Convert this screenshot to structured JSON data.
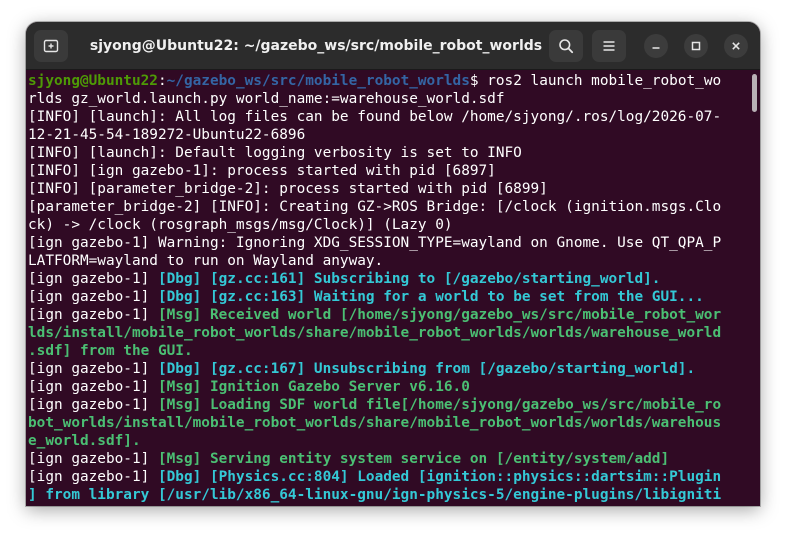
{
  "window": {
    "title": "sjyong@Ubuntu22: ~/gazebo_ws/src/mobile_robot_worlds"
  },
  "titlebar": {
    "new_tab_icon": "new-tab-icon",
    "search_icon": "search-icon",
    "menu_icon": "hamburger-menu-icon",
    "minimize_icon": "minimize-icon",
    "maximize_icon": "maximize-icon",
    "close_icon": "close-icon"
  },
  "colors": {
    "background": "#300a24",
    "titlebar": "#2c2c2c",
    "text": "#ffffff",
    "prompt_user": "#4e9a06",
    "prompt_path": "#3465a4",
    "dbg": "#34c9d6",
    "msg": "#4bbf73"
  },
  "terminal": {
    "lines": [
      [
        {
          "t": "sjyong@Ubuntu22",
          "c": "userhost"
        },
        {
          "t": ":",
          "c": ""
        },
        {
          "t": "~/gazebo_ws/src/mobile_robot_worlds",
          "c": "path"
        },
        {
          "t": "$ ros2 launch mobile_robot_wo",
          "c": ""
        }
      ],
      [
        {
          "t": "rlds gz_world.launch.py world_name:=warehouse_world.sdf",
          "c": ""
        }
      ],
      [
        {
          "t": "[INFO] [launch]: All log files can be found below /home/sjyong/.ros/log/2026-07-",
          "c": ""
        }
      ],
      [
        {
          "t": "12-21-45-54-189272-Ubuntu22-6896",
          "c": ""
        }
      ],
      [
        {
          "t": "[INFO] [launch]: Default logging verbosity is set to INFO",
          "c": ""
        }
      ],
      [
        {
          "t": "[INFO] [ign gazebo-1]: process started with pid [6897]",
          "c": ""
        }
      ],
      [
        {
          "t": "[INFO] [parameter_bridge-2]: process started with pid [6899]",
          "c": ""
        }
      ],
      [
        {
          "t": "[parameter_bridge-2] [INFO]: Creating GZ->ROS Bridge: [/clock (ignition.msgs.Clo",
          "c": ""
        }
      ],
      [
        {
          "t": "ck) -> /clock (rosgraph_msgs/msg/Clock)] (Lazy 0)",
          "c": ""
        }
      ],
      [
        {
          "t": "[ign gazebo-1] Warning: Ignoring XDG_SESSION_TYPE=wayland on Gnome. Use QT_QPA_P",
          "c": ""
        }
      ],
      [
        {
          "t": "LATFORM=wayland to run on Wayland anyway.",
          "c": ""
        }
      ],
      [
        {
          "t": "[ign gazebo-1] ",
          "c": ""
        },
        {
          "t": "[Dbg] [gz.cc:161] Subscribing to [/gazebo/starting_world].",
          "c": "dbg"
        }
      ],
      [
        {
          "t": "[ign gazebo-1] ",
          "c": ""
        },
        {
          "t": "[Dbg] [gz.cc:163] Waiting for a world to be set from the GUI...",
          "c": "dbg"
        }
      ],
      [
        {
          "t": "[ign gazebo-1] ",
          "c": ""
        },
        {
          "t": "[Msg] Received world [/home/sjyong/gazebo_ws/src/mobile_robot_wor",
          "c": "msg"
        }
      ],
      [
        {
          "t": "lds/install/mobile_robot_worlds/share/mobile_robot_worlds/worlds/warehouse_world",
          "c": "msg"
        }
      ],
      [
        {
          "t": ".sdf] from the GUI.",
          "c": "msg"
        }
      ],
      [
        {
          "t": "[ign gazebo-1] ",
          "c": ""
        },
        {
          "t": "[Dbg] [gz.cc:167] Unsubscribing from [/gazebo/starting_world].",
          "c": "dbg"
        }
      ],
      [
        {
          "t": "[ign gazebo-1] ",
          "c": ""
        },
        {
          "t": "[Msg] Ignition Gazebo Server v6.16.0",
          "c": "msg"
        }
      ],
      [
        {
          "t": "[ign gazebo-1] ",
          "c": ""
        },
        {
          "t": "[Msg] Loading SDF world file[/home/sjyong/gazebo_ws/src/mobile_ro",
          "c": "msg"
        }
      ],
      [
        {
          "t": "bot_worlds/install/mobile_robot_worlds/share/mobile_robot_worlds/worlds/warehous",
          "c": "msg"
        }
      ],
      [
        {
          "t": "e_world.sdf].",
          "c": "msg"
        }
      ],
      [
        {
          "t": "[ign gazebo-1] ",
          "c": ""
        },
        {
          "t": "[Msg] Serving entity system service on [/entity/system/add]",
          "c": "msg"
        }
      ],
      [
        {
          "t": "[ign gazebo-1] ",
          "c": ""
        },
        {
          "t": "[Dbg] [Physics.cc:804] Loaded [ignition::physics::dartsim::Plugin",
          "c": "dbg"
        }
      ],
      [
        {
          "t": "] from library [/usr/lib/x86_64-linux-gnu/ign-physics-5/engine-plugins/libigniti",
          "c": "dbg"
        }
      ]
    ]
  }
}
